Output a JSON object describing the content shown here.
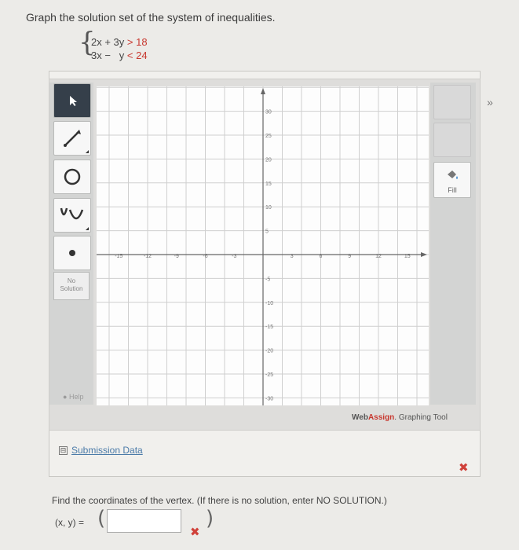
{
  "question": {
    "prompt": "Graph the solution set of the system of inequalities.",
    "ineq1_left": "2x + 3y",
    "ineq1_op": ">",
    "ineq1_right": "18",
    "ineq2_left": "3x −   y",
    "ineq2_op": "<",
    "ineq2_right": "24"
  },
  "toolbar": {
    "no_solution_line1": "No",
    "no_solution_line2": "Solution",
    "help_label": "Help",
    "fill_label": "Fill",
    "expand_label": "»"
  },
  "graph": {
    "x_tick_labels": [
      "-15",
      "-12",
      "-9",
      "-6",
      "-3",
      "3",
      "6",
      "9",
      "12",
      "15"
    ],
    "y_tick_labels": [
      "30",
      "25",
      "20",
      "15",
      "10",
      "5",
      "-5",
      "-10",
      "-15",
      "-20",
      "-25",
      "-30"
    ]
  },
  "brand": {
    "web": "Web",
    "assign": "Assign",
    "suffix": ". Graphing Tool"
  },
  "submission": {
    "toggle": "⊟",
    "label": "Submission Data"
  },
  "vertex": {
    "question": "Find the coordinates of the vertex. (If there is no solution, enter NO SOLUTION.)",
    "label": "(x, y) =",
    "value": "",
    "mark": "✖"
  }
}
